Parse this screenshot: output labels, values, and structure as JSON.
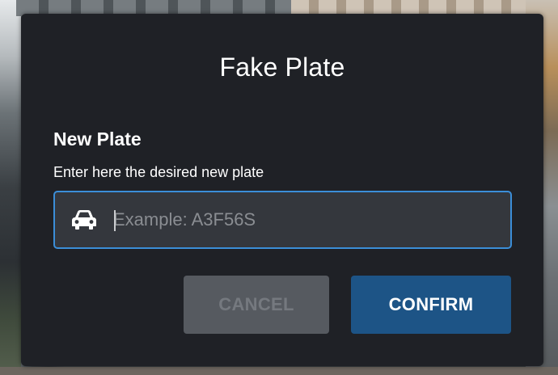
{
  "dialog": {
    "title": "Fake Plate",
    "field_label": "New Plate",
    "field_description": "Enter here the desired new plate",
    "input": {
      "value": "",
      "placeholder": "Example: A3F56S",
      "icon": "car-icon"
    },
    "buttons": {
      "cancel_label": "CANCEL",
      "confirm_label": "CONFIRM"
    }
  },
  "colors": {
    "dialog_background": "#1f2126",
    "input_border_focus": "#3b8ed8",
    "confirm_button": "#1d5486",
    "cancel_button_disabled": "#565a60"
  }
}
